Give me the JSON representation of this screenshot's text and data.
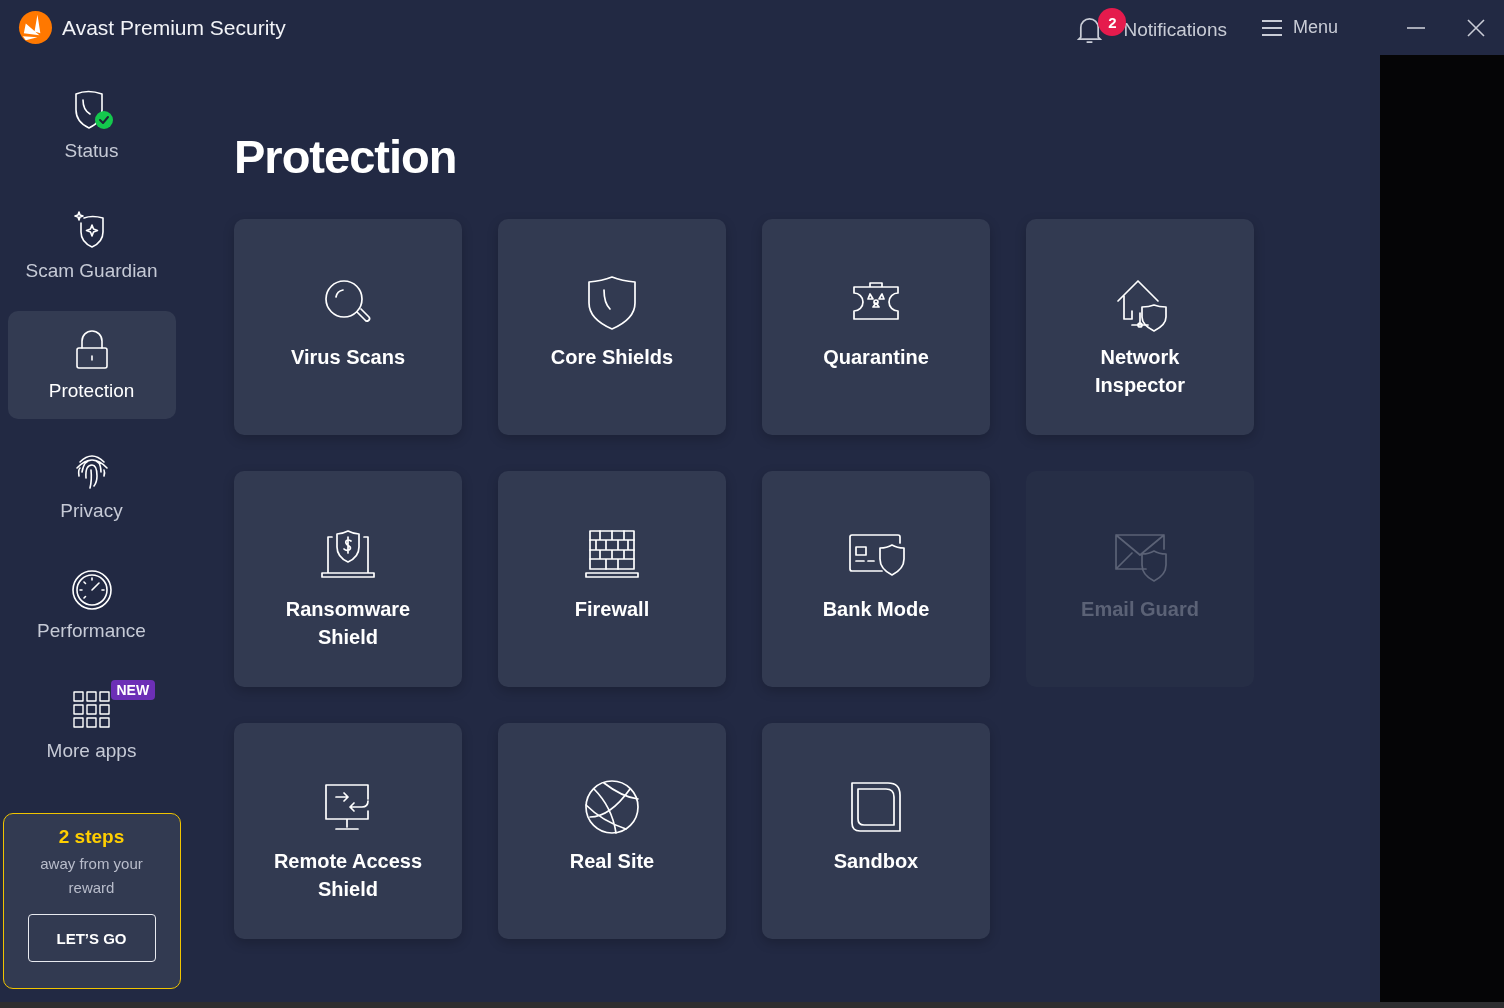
{
  "window": {
    "title": "Avast Premium Security"
  },
  "header": {
    "notifications": {
      "label": "Notifications",
      "count": "2"
    },
    "menu": {
      "label": "Menu"
    }
  },
  "sidebar": {
    "items": [
      {
        "label": "Status",
        "selected": false
      },
      {
        "label": "Scam Guardian",
        "selected": false
      },
      {
        "label": "Protection",
        "selected": true
      },
      {
        "label": "Privacy",
        "selected": false
      },
      {
        "label": "Performance",
        "selected": false
      },
      {
        "label": "More apps",
        "selected": false,
        "badge": "NEW"
      }
    ],
    "reward": {
      "headline": "2 steps",
      "text": "away from your reward",
      "button": "LET’S GO"
    }
  },
  "page": {
    "title": "Protection",
    "tiles": [
      {
        "label": "Virus Scans",
        "disabled": false
      },
      {
        "label": "Core Shields",
        "disabled": false
      },
      {
        "label": "Quarantine",
        "disabled": false
      },
      {
        "label": "Network Inspector",
        "disabled": false
      },
      {
        "label": "Ransomware Shield",
        "disabled": false
      },
      {
        "label": "Firewall",
        "disabled": false
      },
      {
        "label": "Bank Mode",
        "disabled": false
      },
      {
        "label": "Email Guard",
        "disabled": true
      },
      {
        "label": "Remote Access Shield",
        "disabled": false
      },
      {
        "label": "Real Site",
        "disabled": false
      },
      {
        "label": "Sandbox",
        "disabled": false
      }
    ]
  }
}
